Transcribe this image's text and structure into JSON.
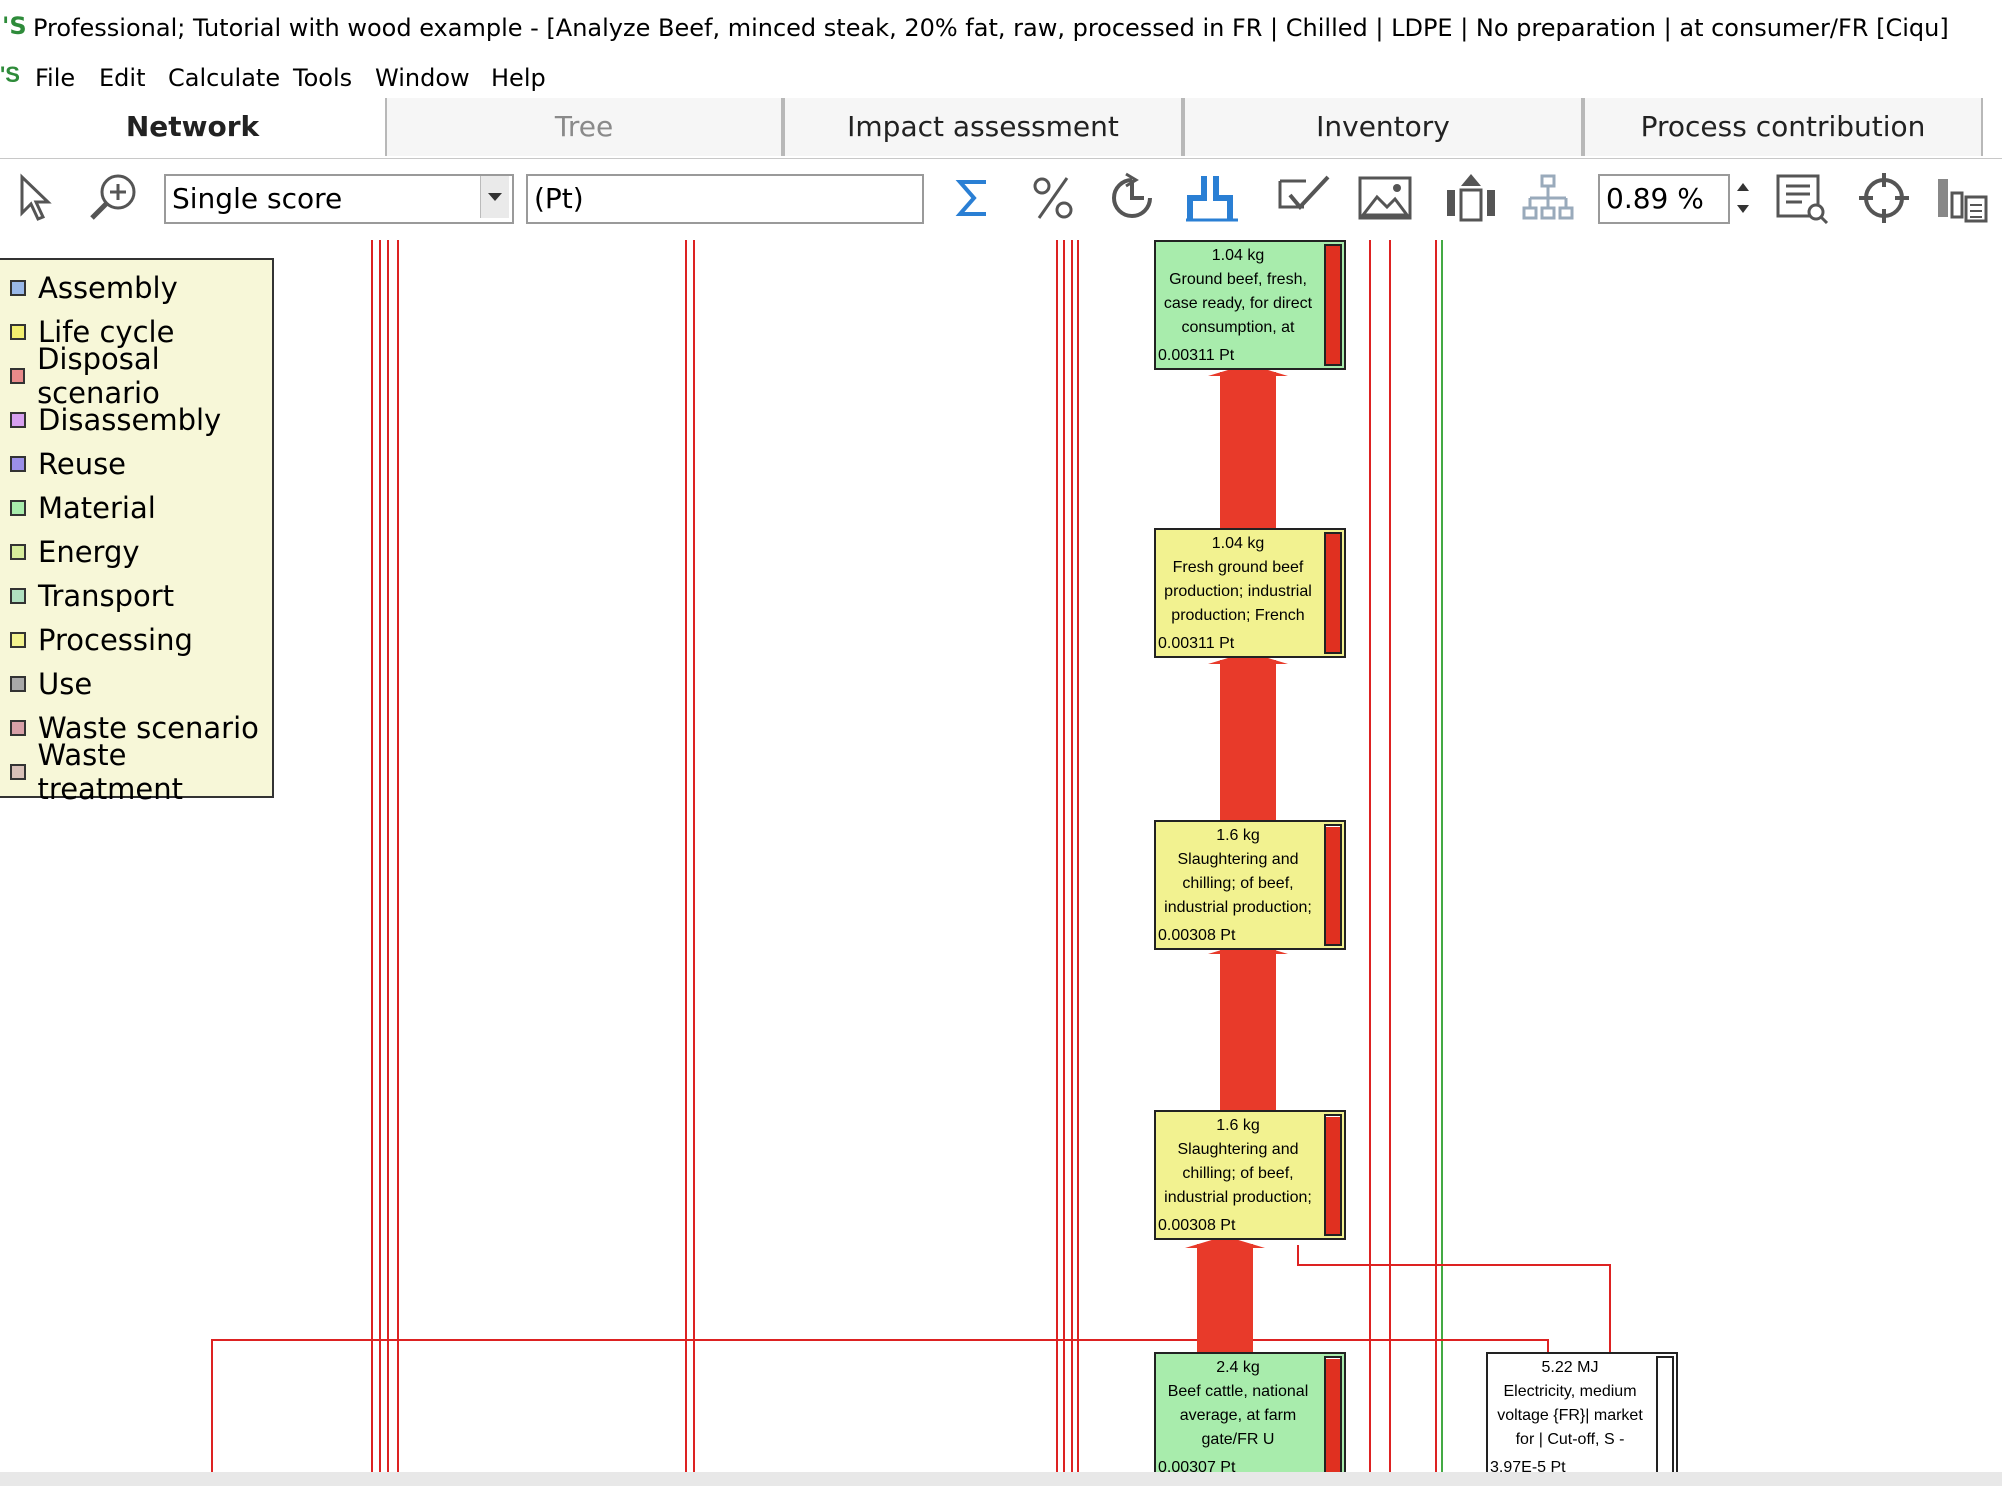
{
  "window": {
    "title": "Professional; Tutorial with wood example - [Analyze Beef, minced steak, 20% fat, raw, processed in FR | Chilled | LDPE | No preparation | at consumer/FR [Ciqu]",
    "logo": "'S"
  },
  "menu": {
    "items": [
      {
        "label": "File"
      },
      {
        "label": "Edit"
      },
      {
        "label": "Calculate"
      },
      {
        "label": "Tools"
      },
      {
        "label": "Window"
      },
      {
        "label": "Help"
      }
    ]
  },
  "tabs": [
    {
      "label": "Network",
      "active": true
    },
    {
      "label": "Tree"
    },
    {
      "label": "Impact assessment"
    },
    {
      "label": "Inventory"
    },
    {
      "label": "Process contribution"
    }
  ],
  "toolbar": {
    "method_select": "Single score",
    "unit_field": "(Pt)",
    "cutoff_value": "0.89 %",
    "icons": [
      "pointer-icon",
      "zoom-icon",
      "sum-icon",
      "percent-icon",
      "refresh-icon",
      "network-layout-icon",
      "check-icon",
      "image-icon",
      "bar-up-icon",
      "hierarchy-icon",
      "report-icon",
      "crosshair-icon",
      "chart-settings-icon"
    ]
  },
  "legend": {
    "items": [
      {
        "label": "Assembly",
        "color": "#9ab8e8"
      },
      {
        "label": "Life cycle",
        "color": "#f2ee70"
      },
      {
        "label": "Disposal scenario",
        "color": "#e88a8a"
      },
      {
        "label": "Disassembly",
        "color": "#d7a0ef"
      },
      {
        "label": "Reuse",
        "color": "#9b8fe8"
      },
      {
        "label": "Material",
        "color": "#a8ecac"
      },
      {
        "label": "Energy",
        "color": "#d6ec9c"
      },
      {
        "label": "Transport",
        "color": "#b0e0c0"
      },
      {
        "label": "Processing",
        "color": "#f2f290"
      },
      {
        "label": "Use",
        "color": "#a8a8a8"
      },
      {
        "label": "Waste scenario",
        "color": "#d8a0a8"
      },
      {
        "label": "Waste treatment",
        "color": "#d8c0b8"
      }
    ]
  },
  "network": {
    "nodes": [
      {
        "amount": "1.04 kg",
        "name": "Ground beef, fresh, case ready, for direct consumption, at",
        "score": "0.00311 Pt",
        "color": "#a8ecac",
        "level": 1.0
      },
      {
        "amount": "1.04 kg",
        "name": "Fresh ground beef production; industrial production; French",
        "score": "0.00311 Pt",
        "color": "#f2f290",
        "level": 1.0
      },
      {
        "amount": "1.6 kg",
        "name": "Slaughtering and chilling; of beef, industrial production;",
        "score": "0.00308 Pt",
        "color": "#f2f290",
        "level": 0.99
      },
      {
        "amount": "1.6 kg",
        "name": "Slaughtering and chilling; of beef, industrial production;",
        "score": "0.00308 Pt",
        "color": "#f2f290",
        "level": 0.99
      },
      {
        "amount": "2.4 kg",
        "name": "Beef cattle, national average, at farm gate/FR U",
        "score": "0.00307 Pt",
        "color": "#a8ecac",
        "level": 0.99
      },
      {
        "amount": "5.22 MJ",
        "name": "Electricity, medium voltage {FR}| market for | Cut-off, S -",
        "score": "3.97E-5 Pt",
        "color": "#ffffff",
        "level": 0.0
      }
    ]
  }
}
